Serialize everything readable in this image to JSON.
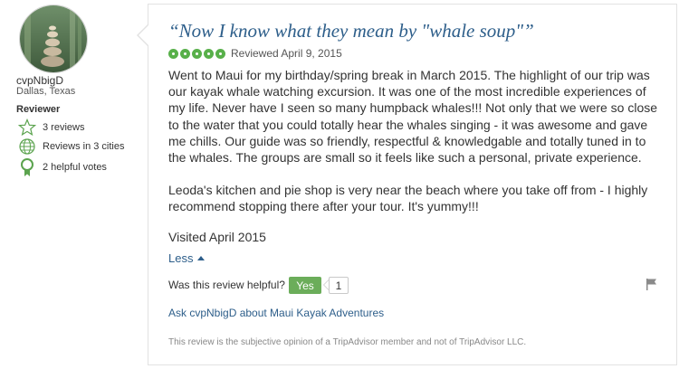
{
  "reviewer": {
    "username": "cvpNbigD",
    "location": "Dallas, Texas",
    "title": "Reviewer",
    "badges": [
      {
        "icon": "star-outline-icon",
        "label": "3 reviews"
      },
      {
        "icon": "globe-icon",
        "label": "Reviews in 3 cities"
      },
      {
        "icon": "ribbon-icon",
        "label": "2 helpful votes"
      }
    ]
  },
  "review": {
    "title": "“Now I know what they mean by \"whale soup\"”",
    "rating": 5,
    "rating_max": 5,
    "reviewed_date": "Reviewed April 9, 2015",
    "paragraphs": [
      "Went to Maui for my birthday/spring break in March 2015. The highlight of our trip was our kayak whale watching excursion. It was one of the most incredible experiences of my life. Never have I seen so many humpback whales!!! Not only that we were so close to the water that you could totally hear the whales singing - it was awesome and gave me chills. Our guide was so friendly, respectful & knowledgable and totally tuned in to the whales. The groups are small so it feels like such a personal, private experience.",
      "Leoda's kitchen and pie shop is very near the beach where you take off from - I highly recommend stopping there after your tour. It's yummy!!!"
    ],
    "visited": "Visited April 2015",
    "less_label": "Less",
    "helpful_question": "Was this review helpful?",
    "yes_label": "Yes",
    "helpful_count": "1",
    "ask_link": "Ask cvpNbigD about Maui Kayak Adventures",
    "disclaimer": "This review is the subjective opinion of a TripAdvisor member and not of TripAdvisor LLC."
  },
  "colors": {
    "accent_blue": "#2d5e8a",
    "rating_green": "#58b04a",
    "yes_green": "#6bad5a"
  }
}
